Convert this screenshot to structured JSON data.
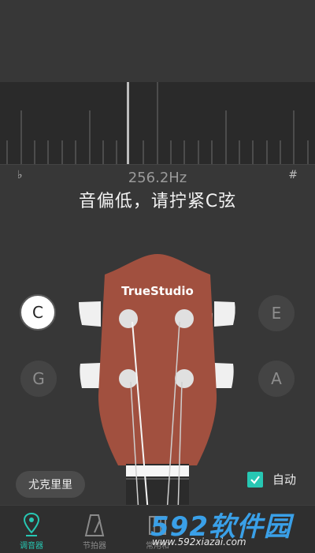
{
  "meter": {
    "frequency": "256.2Hz",
    "flat_symbol": "♭",
    "sharp_symbol": "#"
  },
  "hint": "音偏低，请拧紧C弦",
  "brand": "TrueStudio",
  "strings": [
    {
      "note": "C",
      "active": true
    },
    {
      "note": "E",
      "active": false
    },
    {
      "note": "G",
      "active": false
    },
    {
      "note": "A",
      "active": false
    }
  ],
  "instrument_button": "尤克里里",
  "auto": {
    "label": "自动",
    "checked": true
  },
  "tabs": [
    {
      "label": "调音器",
      "icon": "tuner-pin-icon",
      "active": true
    },
    {
      "label": "节拍器",
      "icon": "metronome-icon",
      "active": false
    },
    {
      "label": "常用和",
      "icon": "chord-icon",
      "active": false
    }
  ],
  "watermark": {
    "title": "592软件园",
    "url": "www.592xiazai.com"
  },
  "colors": {
    "accent": "#27c7b3",
    "headstock": "#a1503f",
    "background": "#373737"
  }
}
